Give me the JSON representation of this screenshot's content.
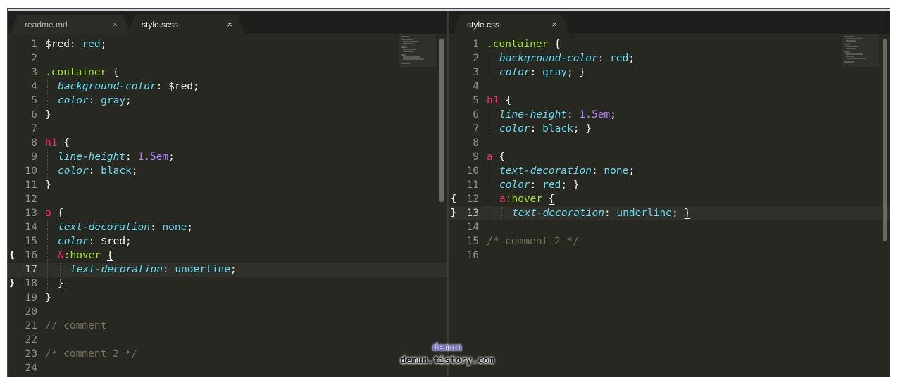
{
  "left_editor": {
    "tabs": [
      {
        "label": "readme.md",
        "close": "×"
      },
      {
        "label": "style.scss",
        "close": "×"
      }
    ],
    "line_numbers": [
      "1",
      "2",
      "3",
      "4",
      "5",
      "6",
      "7",
      "8",
      "9",
      "10",
      "11",
      "12",
      "13",
      "14",
      "15",
      "16",
      "17",
      "18",
      "19",
      "20",
      "21",
      "22",
      "23",
      "24"
    ],
    "code": {
      "l1_var": "$red",
      "l1_colon": ": ",
      "l1_value": "red",
      "l1_end": ";",
      "l3_selector": ".container",
      "l3_brace": " {",
      "l4_prop": "background-color",
      "l4_colon": ": ",
      "l4_value": "$red",
      "l4_end": ";",
      "l5_prop": "color",
      "l5_colon": ": ",
      "l5_value": "gray",
      "l5_end": ";",
      "l6_brace": "}",
      "l8_tag": "h1",
      "l8_brace": " {",
      "l9_prop": "line-height",
      "l9_colon": ": ",
      "l9_value": "1.5em",
      "l9_end": ";",
      "l10_prop": "color",
      "l10_colon": ": ",
      "l10_value": "black",
      "l10_end": ";",
      "l11_brace": "}",
      "l13_tag": "a",
      "l13_brace": " {",
      "l14_prop": "text-decoration",
      "l14_colon": ": ",
      "l14_value": "none",
      "l14_end": ";",
      "l15_prop": "color",
      "l15_colon": ": ",
      "l15_value": "$red",
      "l15_end": ";",
      "l16_amp": "&",
      "l16_pseudo": ":hover",
      "l16_space": " ",
      "l16_brace": "{",
      "l17_prop": "text-decoration",
      "l17_colon": ": ",
      "l17_value": "underline",
      "l17_end": ";",
      "l18_brace": "}",
      "l19_brace": "}",
      "l21_comment": "// comment",
      "l23_comment": "/* comment 2 */"
    }
  },
  "right_editor": {
    "tabs": [
      {
        "label": "style.css",
        "close": "×"
      }
    ],
    "line_numbers": [
      "1",
      "2",
      "3",
      "4",
      "5",
      "6",
      "7",
      "8",
      "9",
      "10",
      "11",
      "12",
      "13",
      "14",
      "15",
      "16"
    ],
    "code": {
      "l1_selector": ".container",
      "l1_brace": " {",
      "l2_prop": "background-color",
      "l2_colon": ": ",
      "l2_value": "red",
      "l2_end": ";",
      "l3_prop": "color",
      "l3_colon": ": ",
      "l3_value": "gray",
      "l3_end": "; }",
      "l5_tag": "h1",
      "l5_brace": " {",
      "l6_prop": "line-height",
      "l6_colon": ": ",
      "l6_value": "1.5em",
      "l6_end": ";",
      "l7_prop": "color",
      "l7_colon": ": ",
      "l7_value": "black",
      "l7_end": "; }",
      "l9_tag": "a",
      "l9_brace": " {",
      "l10_prop": "text-decoration",
      "l10_colon": ": ",
      "l10_value": "none",
      "l10_end": ";",
      "l11_prop": "color",
      "l11_colon": ": ",
      "l11_value": "red",
      "l11_end": "; }",
      "l12_tag": "a",
      "l12_pseudo": ":hover",
      "l12_space": " ",
      "l12_brace": "{",
      "l13_prop": "text-decoration",
      "l13_colon": ": ",
      "l13_value": "underline",
      "l13_semi": "; ",
      "l13_brace": "}",
      "l15_comment": "/* comment 2 */"
    }
  },
  "fold_markers": {
    "open": "{",
    "close": "}"
  },
  "watermark": {
    "name": "demun",
    "url": "demun.tistory.com"
  },
  "colors": {
    "background": "#272822",
    "selector": "#a6e22e",
    "tag": "#f92672",
    "property": "#66d9ef",
    "number": "#ae81ff",
    "comment": "#75715e",
    "text": "#f8f8f2"
  }
}
